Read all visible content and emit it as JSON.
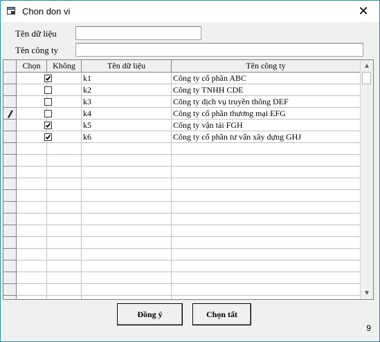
{
  "window": {
    "title": "Chon don vi",
    "close_symbol": "✕",
    "status_number": "9"
  },
  "form": {
    "ten_du_lieu_label": "Tên dữ liệu",
    "ten_du_lieu_value": "",
    "ten_cong_ty_label": "Tên công ty",
    "ten_cong_ty_value": ""
  },
  "grid": {
    "columns": [
      "Chọn",
      "Không",
      "Tên dữ liệu",
      "Tên công ty"
    ],
    "rows": [
      {
        "checked": true,
        "code": "k1",
        "company": "Công ty cổ phần ABC",
        "editing": false
      },
      {
        "checked": false,
        "code": "k2",
        "company": "Công ty TNHH CDE",
        "editing": false
      },
      {
        "checked": false,
        "code": "k3",
        "company": "Công ty dịch vụ truyền thông DEF",
        "editing": false
      },
      {
        "checked": false,
        "code": "k4",
        "company": "Công ty cổ phần thương mại EFG",
        "editing": true
      },
      {
        "checked": true,
        "code": "k5",
        "company": "Công ty vận tải FGH",
        "editing": false
      },
      {
        "checked": true,
        "code": "k6",
        "company": "Công ty cổ phần tư vấn xây dựng GHJ",
        "editing": false
      }
    ],
    "empty_row_count": 14
  },
  "buttons": {
    "ok": "Đồng ý",
    "select_all": "Chọn tất"
  }
}
